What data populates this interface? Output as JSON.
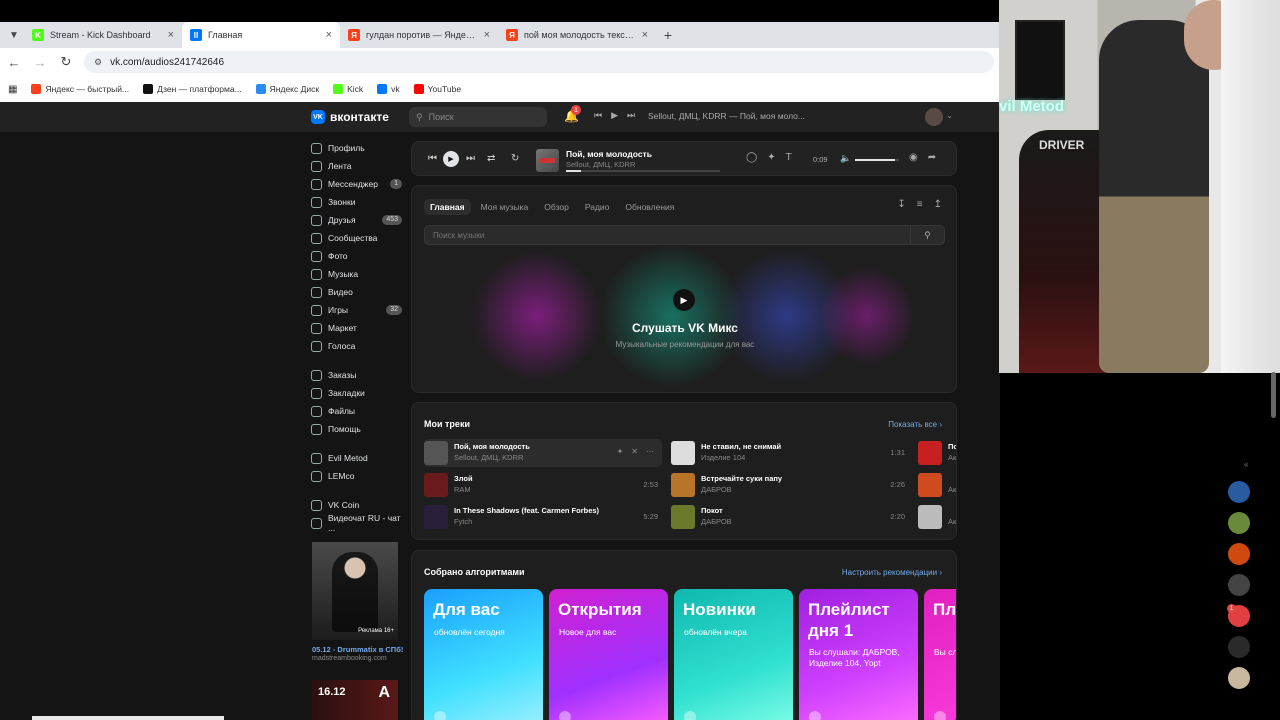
{
  "browser": {
    "tabs": [
      {
        "label": "Stream - Kick Dashboard",
        "fav": "K",
        "favColor": "#53fc18"
      },
      {
        "label": "Главная",
        "fav": "II",
        "favColor": "#0077ff"
      },
      {
        "label": "гулдан поротив — Яндекс: на",
        "fav": "Я",
        "favColor": "#fc3f1d"
      },
      {
        "label": "пой моя молодость текст — Я",
        "fav": "Я",
        "favColor": "#fc3f1d"
      }
    ],
    "url": "vk.com/audios241742646",
    "bookmarks": [
      {
        "label": "Яндекс — быстрый...",
        "color": "#fc3f1d"
      },
      {
        "label": "Дзен — платформа...",
        "color": "#111111"
      },
      {
        "label": "Яндекс Диск",
        "color": "#2a8cf0"
      },
      {
        "label": "Kick",
        "color": "#53fc18"
      },
      {
        "label": "vk",
        "color": "#0077ff"
      },
      {
        "label": "YouTube",
        "color": "#ff0000"
      }
    ]
  },
  "vk": {
    "logo": "вконтакте",
    "search_placeholder": "Поиск",
    "bell_count": "1",
    "header_track": "Sellout, ДМЦ, KDRR — Пой, моя моло...",
    "sidebar": [
      {
        "label": "Профиль"
      },
      {
        "label": "Лента"
      },
      {
        "label": "Мессенджер",
        "count": "1"
      },
      {
        "label": "Звонки"
      },
      {
        "label": "Друзья",
        "count": "453"
      },
      {
        "label": "Сообщества"
      },
      {
        "label": "Фото"
      },
      {
        "label": "Музыка"
      },
      {
        "label": "Видео"
      },
      {
        "label": "Игры",
        "count": "32"
      },
      {
        "label": "Маркет"
      },
      {
        "label": "Голоса"
      }
    ],
    "sidebar2": [
      {
        "label": "Заказы"
      },
      {
        "label": "Закладки"
      },
      {
        "label": "Файлы"
      },
      {
        "label": "Помощь"
      }
    ],
    "sidebar3": [
      {
        "label": "Evil Metod"
      },
      {
        "label": "LEMco"
      }
    ],
    "sidebar4": [
      {
        "label": "VK Coin"
      },
      {
        "label": "Видеочат RU - чат ..."
      }
    ],
    "ad": {
      "tag": "Реклама 16+",
      "title": "05.12 - Drummatix в СПб!",
      "sub": "madstreambooking.com",
      "ad2_left": "16.12",
      "ad2_right": "A"
    },
    "player": {
      "title": "Пой, моя молодость",
      "artist": "Sellout, ДМЦ, KDRR",
      "time": "0:09",
      "progress": 0.1,
      "volume": 0.9
    },
    "music_tabs": [
      "Главная",
      "Моя музыка",
      "Обзор",
      "Радио",
      "Обновления"
    ],
    "music_search_placeholder": "Поиск музыки",
    "mix": {
      "title": "Слушать VK Микс",
      "sub": "Музыкальные рекомендации для вас"
    },
    "tracks": {
      "title": "Мои треки",
      "link": "Показать все",
      "left": [
        {
          "name": "Пой, моя молодость",
          "artist": "Sellout, ДМЦ, KDRR",
          "dur": "",
          "color": "#555555"
        },
        {
          "name": "Злой",
          "artist": "RAM",
          "dur": "2:53",
          "color": "#6a1a1a"
        },
        {
          "name": "In These Shadows (feat. Carmen Forbes)",
          "artist": "Fytch",
          "dur": "5:29",
          "color": "#2a1f3a"
        }
      ],
      "right": [
        {
          "name": "Не ставил, не снимай",
          "artist": "Изделие 104",
          "dur": "1:31",
          "color": "#dddddd"
        },
        {
          "name": "Встречайте суки папу",
          "artist": "ДАБРОВ",
          "dur": "2:26",
          "color": "#b8752a"
        },
        {
          "name": "Покот",
          "artist": "ДАБРОВ",
          "dur": "2:20",
          "color": "#6a7a2a"
        }
      ],
      "edge": [
        {
          "name": "По",
          "artist": "Ак",
          "color": "#c82020"
        },
        {
          "name": "",
          "artist": "Ак",
          "color": "#d04a20"
        },
        {
          "name": "",
          "artist": "Ак",
          "color": "#bbbbbb"
        }
      ]
    },
    "algo": {
      "title": "Собрано алгоритмами",
      "link": "Настроить рекомендации",
      "playlists": [
        {
          "title": "Для вас",
          "sub": "обновлён сегодня",
          "bg": "linear-gradient(160deg,#1aa0ff,#40e0ff 60%,#a0f0ff)"
        },
        {
          "title": "Открытия",
          "sub": "Новое для вас",
          "bg": "linear-gradient(160deg,#d020d0,#a030ff 60%,#ff60ff)"
        },
        {
          "title": "Новинки",
          "sub": "обновлён вчера",
          "bg": "linear-gradient(160deg,#10b8b0,#30e0d0 60%,#80ffe8)"
        },
        {
          "title": "Плейлист дня 1",
          "sub": "Вы слушали: ДАБРОВ, Изделие 104, Yopt",
          "bg": "linear-gradient(160deg,#a020e0,#d040ff 60%,#ff70ff)"
        },
        {
          "title": "Пл дн",
          "sub": "Вы сл Горш",
          "bg": "linear-gradient(160deg,#e020c0,#ff40e0)"
        }
      ]
    }
  },
  "camera": {
    "neon": "vil Metod",
    "chair": "DRIVER"
  }
}
